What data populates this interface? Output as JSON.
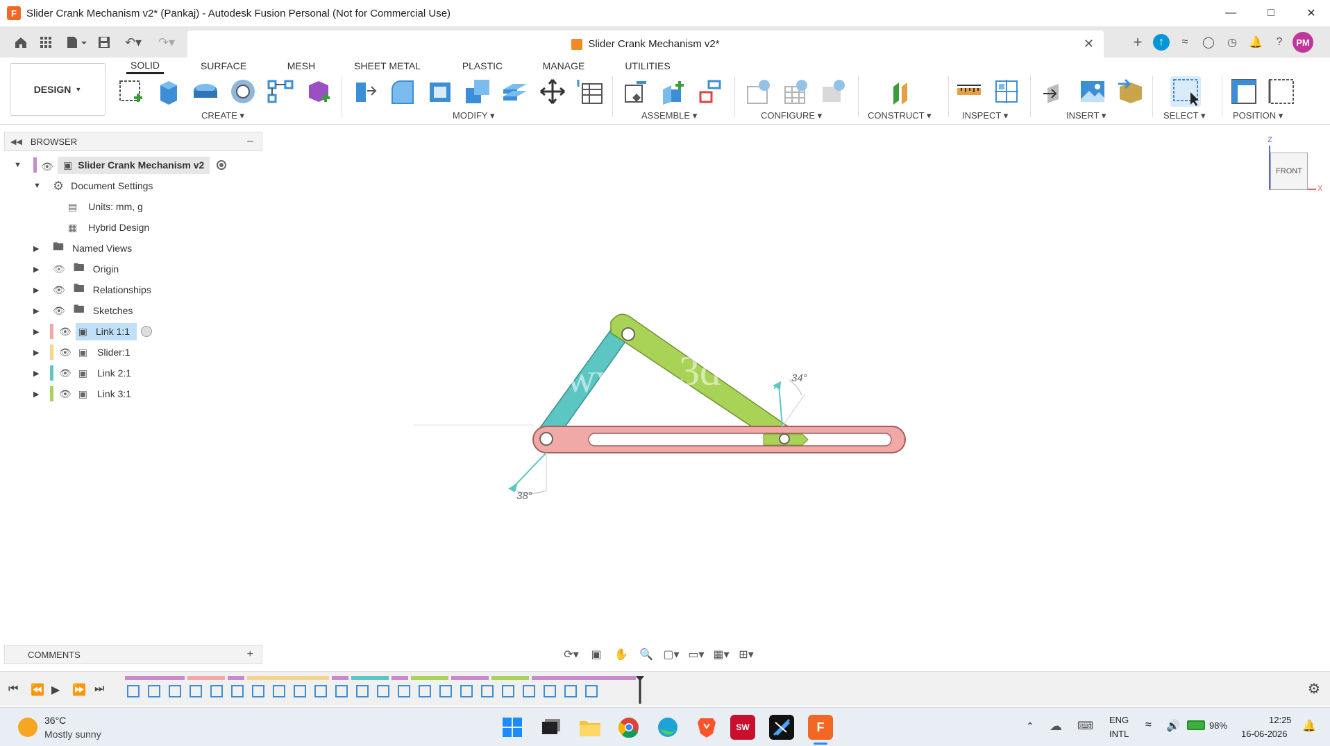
{
  "window": {
    "title": "Slider Crank Mechanism v2* (Pankaj) - Autodesk Fusion Personal (Not for Commercial Use)"
  },
  "doc_tab": {
    "title": "Slider Crank Mechanism v2*"
  },
  "user": {
    "initials": "PM"
  },
  "workspace": {
    "label": "DESIGN"
  },
  "ribbon_tabs": [
    "SOLID",
    "SURFACE",
    "MESH",
    "SHEET METAL",
    "PLASTIC",
    "MANAGE",
    "UTILITIES"
  ],
  "groups": {
    "create": "CREATE",
    "modify": "MODIFY",
    "assemble": "ASSEMBLE",
    "configure": "CONFIGURE",
    "construct": "CONSTRUCT",
    "inspect": "INSPECT",
    "insert": "INSERT",
    "select": "SELECT",
    "position": "POSITION"
  },
  "browser": {
    "header": "BROWSER",
    "root": "Slider Crank Mechanism v2",
    "items": [
      {
        "label": "Document Settings"
      },
      {
        "label": "Units: mm, g"
      },
      {
        "label": "Hybrid Design"
      },
      {
        "label": "Named Views"
      },
      {
        "label": "Origin"
      },
      {
        "label": "Relationships"
      },
      {
        "label": "Sketches"
      },
      {
        "label": "Link 1:1"
      },
      {
        "label": "Slider:1"
      },
      {
        "label": "Link 2:1"
      },
      {
        "label": "Link 3:1"
      }
    ]
  },
  "canvas": {
    "angle_top": "34°",
    "angle_bottom": "38°",
    "viewcube_label": "FRONT",
    "axis_z": "Z",
    "axis_x": "X"
  },
  "comments": {
    "label": "COMMENTS"
  },
  "colors": {
    "link_teal": "#5cc6c2",
    "link_green": "#a9d357",
    "slider_pink": "#f1a9a8",
    "accent_blue": "#0696d7"
  },
  "taskbar": {
    "weather_temp": "36°C",
    "weather_desc": "Mostly sunny",
    "lang1": "ENG",
    "lang2": "INTL",
    "battery": "98%",
    "time": "12:25",
    "date": "16-06-2026"
  }
}
